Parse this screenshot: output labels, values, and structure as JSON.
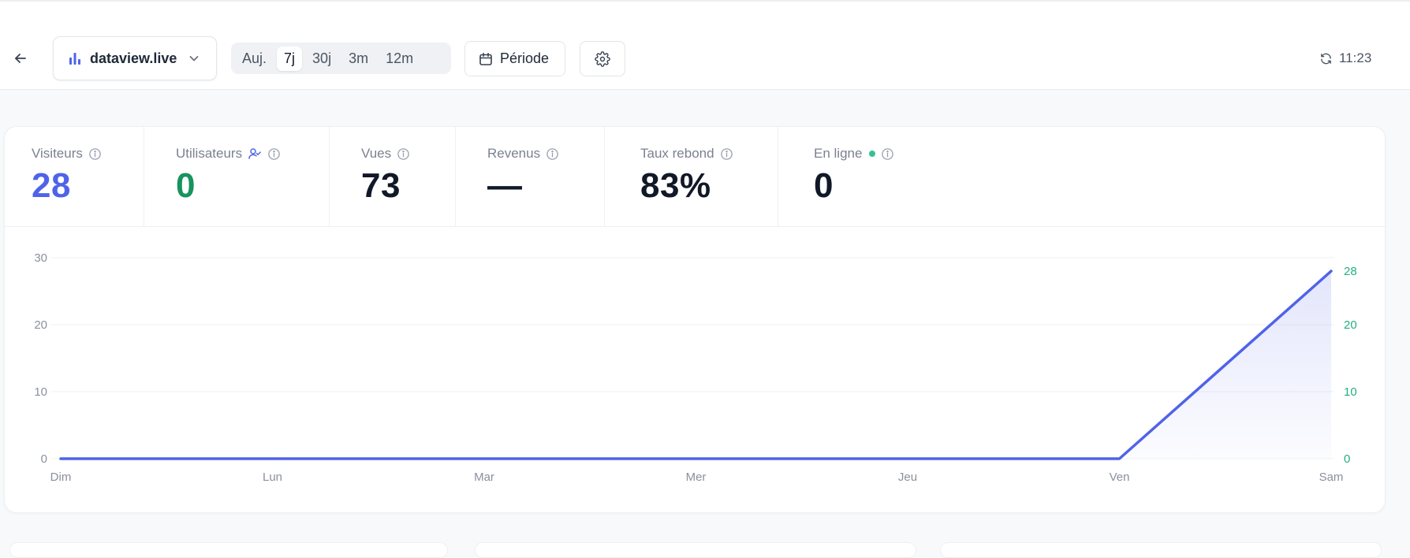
{
  "header": {
    "site_name": "dataview.live",
    "ranges": [
      {
        "label": "Auj.",
        "active": false
      },
      {
        "label": "7j",
        "active": true
      },
      {
        "label": "30j",
        "active": false
      },
      {
        "label": "3m",
        "active": false
      },
      {
        "label": "12m",
        "active": false
      }
    ],
    "period_label": "Période",
    "last_refresh": "11:23"
  },
  "stats": [
    {
      "key": "visitors",
      "label": "Visiteurs",
      "value": "28",
      "color": "#4f63e9",
      "has_info": true
    },
    {
      "key": "users",
      "label": "Utilisateurs",
      "value": "0",
      "color": "#17935f",
      "has_info": true,
      "user_icon": true
    },
    {
      "key": "views",
      "label": "Vues",
      "value": "73",
      "color": "#111827",
      "has_info": true
    },
    {
      "key": "revenue",
      "label": "Revenus",
      "value": "—",
      "color": "#111827",
      "has_info": true
    },
    {
      "key": "bounce",
      "label": "Taux rebond",
      "value": "83%",
      "color": "#111827",
      "has_info": true
    },
    {
      "key": "online",
      "label": "En ligne",
      "value": "0",
      "color": "#111827",
      "has_info": true,
      "live_dot": true
    }
  ],
  "colors": {
    "accent": "#4f63e9",
    "users_green": "#17935f",
    "right_axis_green": "#22b07d",
    "live_dot": "#34c38f"
  },
  "chart_data": {
    "type": "area",
    "x": [
      "Dim",
      "Lun",
      "Mar",
      "Mer",
      "Jeu",
      "Ven",
      "Sam"
    ],
    "series": [
      {
        "values": [
          0,
          0,
          0,
          0,
          0,
          0,
          28
        ],
        "color": "#4f63e9"
      }
    ],
    "ylim": [
      0,
      30
    ],
    "yticks": [
      0,
      10,
      20,
      30
    ],
    "y2lim": [
      0,
      28
    ],
    "y2ticks": [
      0,
      10,
      20,
      28
    ],
    "grid": true,
    "legend": "none"
  }
}
